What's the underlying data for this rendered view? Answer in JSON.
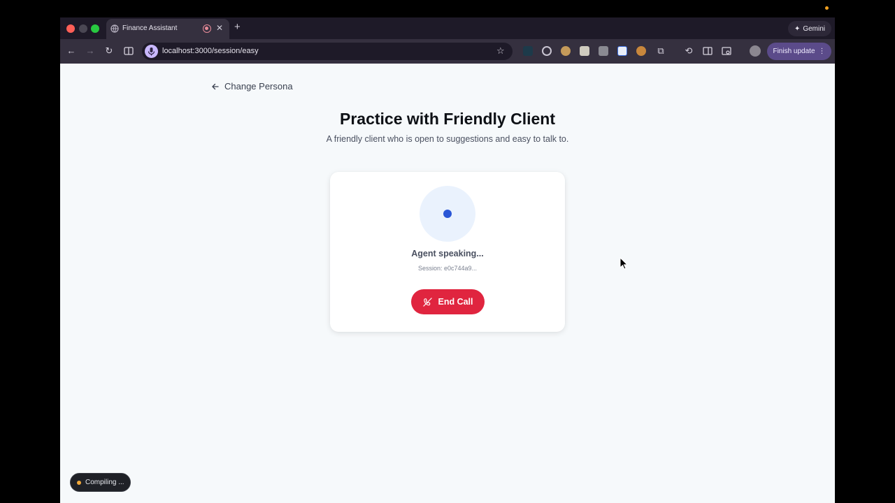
{
  "browser": {
    "tab": {
      "title": "Finance Assistant"
    },
    "gemini_label": "Gemini",
    "address_bar": {
      "url": "localhost:3000/session/easy"
    },
    "finish_update_label": "Finish update",
    "icons": [
      "back-icon",
      "forward-icon",
      "reload-icon",
      "side-panel-icon",
      "microphone-icon",
      "bookmark-star-icon",
      "extensions-icon",
      "history-icon",
      "reading-list-icon",
      "search-tab-icon",
      "profile-avatar",
      "menu-icon"
    ]
  },
  "page": {
    "back_link_label": "Change Persona",
    "title": "Practice with Friendly Client",
    "subtitle": "A friendly client who is open to suggestions and easy to talk to.",
    "call_card": {
      "status": "Agent speaking...",
      "session": "Session: e0c744a9...",
      "end_call_label": "End Call"
    },
    "compiling_label": "Compiling ..."
  },
  "colors": {
    "accent_blue": "#2a56d6",
    "end_call_red": "#e0253f",
    "page_background": "#f6f9fb",
    "browser_chrome": "#35303f",
    "compiling_dot": "#f2a93b"
  }
}
